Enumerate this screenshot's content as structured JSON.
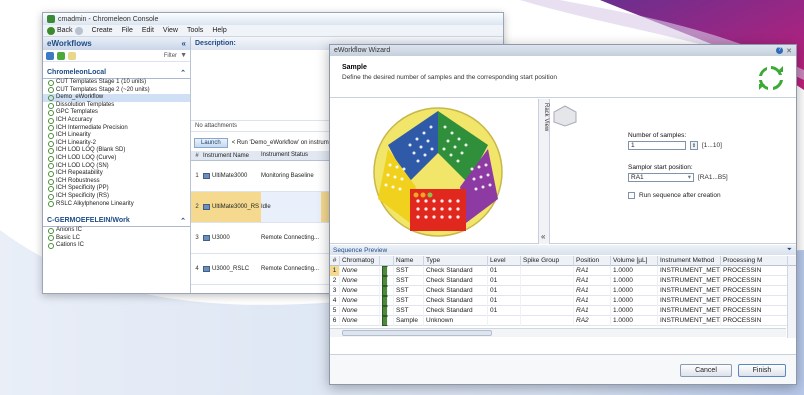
{
  "console": {
    "title": "cmadmin - Chromeleon Console",
    "menu": [
      "Back",
      "Create",
      "File",
      "Edit",
      "View",
      "Tools",
      "Help"
    ],
    "panel_title": "eWorkflows",
    "filter_label": "Filter",
    "group1": "ChromeleonLocal",
    "items1": [
      "CUT Templates Stage 1 (10 units)",
      "CUT Templates Stage 2 (~20 units)",
      "Demo_eWorkflow",
      "Dissolution Templates",
      "GPC Templates",
      "ICH Accuracy",
      "ICH Intermediate Precision",
      "ICH Linearity",
      "ICH Linearity-2",
      "ICH LOD LOQ (Blank SD)",
      "ICH LOD LOQ (Curve)",
      "ICH LOD LOQ (SN)",
      "ICH Repeatability",
      "ICH Robustness",
      "ICH Specificity (PP)",
      "ICH Specificity (RS)",
      "RSLC Alkylphenone Linearity"
    ],
    "group2": "C-GERMOEFELEIN/Work",
    "items2": [
      "Anions IC",
      "Basic LC",
      "Cations IC"
    ],
    "description": "Description:",
    "no_attachments": "No attachments",
    "launch": "Launch",
    "run_text": "< Run 'Demo_eWorkflow' on instrum",
    "col_num": "#",
    "col_name": "Instrument Name",
    "col_status": "Instrument Status",
    "instruments": [
      {
        "n": "1",
        "name": "UltiMate3000",
        "status": "Monitoring Baseline"
      },
      {
        "n": "2",
        "name": "UltiMate3000_RS",
        "status": "Idle"
      },
      {
        "n": "3",
        "name": "U3000",
        "status": "Remote Connecting..."
      },
      {
        "n": "4",
        "name": "U3000_RSLC",
        "status": "Remote Connecting..."
      }
    ]
  },
  "wizard": {
    "title": "eWorkflow Wizard",
    "section": "Sample",
    "subtitle": "Define the desired number of samples and the corresponding start position",
    "rack_view": "Rack View",
    "num_samples_label": "Number of samples:",
    "num_samples_value": "1",
    "num_range": "[1...10]",
    "start_label": "Samplor start position:",
    "start_value": "RA1",
    "start_range": "[RA1...B5]",
    "run_after": "Run sequence after creation",
    "seq_title": "Sequence Preview",
    "seq_cols": [
      "#",
      "Chromatog",
      "Name",
      "Type",
      "Level",
      "Spike Group",
      "Position",
      "Volume [µL]",
      "Instrument Method",
      "Processing M"
    ],
    "rows": [
      [
        "1",
        "None",
        "SST",
        "Check Standard",
        "01",
        "",
        "RA1",
        "1.0000",
        "INSTRUMENT_MET...",
        "PROCESSIN"
      ],
      [
        "2",
        "None",
        "SST",
        "Check Standard",
        "01",
        "",
        "RA1",
        "1.0000",
        "INSTRUMENT_MET...",
        "PROCESSIN"
      ],
      [
        "3",
        "None",
        "SST",
        "Check Standard",
        "01",
        "",
        "RA1",
        "1.0000",
        "INSTRUMENT_MET...",
        "PROCESSIN"
      ],
      [
        "4",
        "None",
        "SST",
        "Check Standard",
        "01",
        "",
        "RA1",
        "1.0000",
        "INSTRUMENT_MET...",
        "PROCESSIN"
      ],
      [
        "5",
        "None",
        "SST",
        "Check Standard",
        "01",
        "",
        "RA1",
        "1.0000",
        "INSTRUMENT_MET...",
        "PROCESSIN"
      ],
      [
        "6",
        "None",
        "Sample",
        "Unknown",
        "",
        "",
        "RA2",
        "1.0000",
        "INSTRUMENT_MET...",
        "PROCESSIN"
      ]
    ],
    "cancel": "Cancel",
    "finish": "Finish"
  },
  "colors": {
    "accent": "#1d4c86",
    "selection": "#f5d98e",
    "logo": "#3aaa35"
  }
}
